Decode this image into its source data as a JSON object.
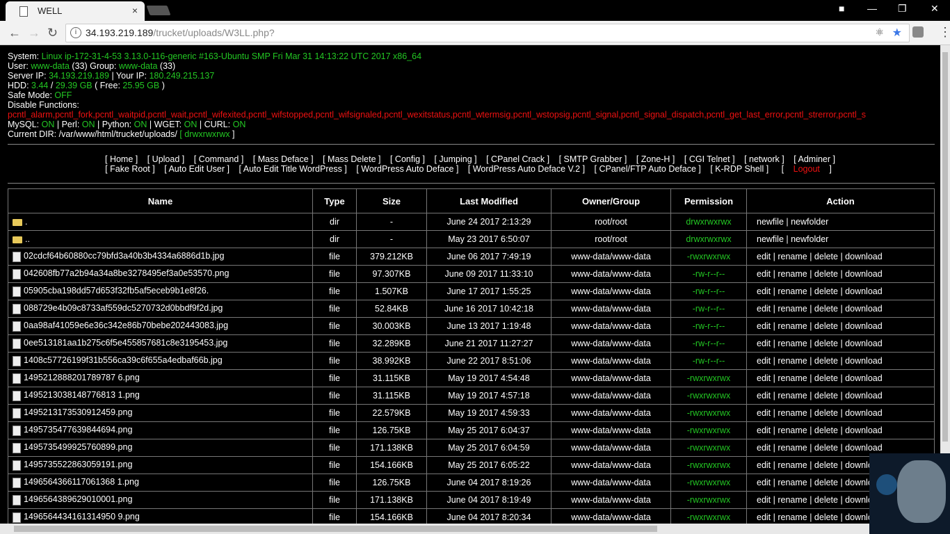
{
  "browser": {
    "tab_title": "WELL",
    "tab_close": "×",
    "url_host": "34.193.219.189",
    "url_path": "/trucket/uploads/W3LL.php?"
  },
  "sysinfo": {
    "system_label": "System:",
    "system_value": "Linux ip-172-31-4-53 3.13.0-116-generic #163-Ubuntu SMP Fri Mar 31 14:13:22 UTC 2017 x86_64",
    "user_label": "User:",
    "user_value": "www-data",
    "user_id": "(33)",
    "group_label": "Group:",
    "group_value": "www-data",
    "group_id": "(33)",
    "server_ip_label": "Server IP:",
    "server_ip": "34.193.219.189",
    "your_ip_label": "| Your IP:",
    "your_ip": "180.249.215.137",
    "hdd_label": "HDD:",
    "hdd_used": "3.44",
    "hdd_total": "29.39 GB",
    "hdd_free_label": "( Free:",
    "hdd_free": "25.95 GB",
    "hdd_close": ")",
    "safe_mode_label": "Safe Mode:",
    "safe_mode": "OFF",
    "disable_label": "Disable Functions:",
    "disable_value": "pcntl_alarm,pcntl_fork,pcntl_waitpid,pcntl_wait,pcntl_wifexited,pcntl_wifstopped,pcntl_wifsignaled,pcntl_wexitstatus,pcntl_wtermsig,pcntl_wstopsig,pcntl_signal,pcntl_signal_dispatch,pcntl_get_last_error,pcntl_strerror,pcntl_s",
    "mysql_label": "MySQL:",
    "mysql": "ON",
    "perl_label": "| Perl:",
    "perl": "ON",
    "python_label": "| Python:",
    "python": "ON",
    "wget_label": "| WGET:",
    "wget": "ON",
    "curl_label": "| CURL:",
    "curl": "ON",
    "cwd_label": "Current DIR: /var/www/html/trucket/uploads/",
    "cwd_perm_open": "[",
    "cwd_perm": "drwxrwxrwx",
    "cwd_perm_close": "]"
  },
  "menu": {
    "row1": [
      "[ Home ]",
      "[ Upload ]",
      "[ Command ]",
      "[ Mass Deface ]",
      "[ Mass Delete ]",
      "[ Config ]",
      "[ Jumping ]",
      "[ CPanel Crack ]",
      "[ SMTP Grabber ]",
      "[ Zone-H ]",
      "[ CGI Telnet ]",
      "[ network ]",
      "[ Adminer ]"
    ],
    "row2": [
      "[ Fake Root ]",
      "[ Auto Edit User ]",
      "[ Auto Edit Title WordPress ]",
      "[ WordPress Auto Deface ]",
      "[ WordPress Auto Deface V.2 ]",
      "[ CPanel/FTP Auto Deface ]",
      "[ K-RDP Shell ]"
    ],
    "logout_open": "[",
    "logout": "Logout",
    "logout_close": "]"
  },
  "table": {
    "headers": [
      "Name",
      "Type",
      "Size",
      "Last Modified",
      "Owner/Group",
      "Permission",
      "Action"
    ],
    "rows": [
      {
        "name": ".",
        "kind": "folder",
        "type": "dir",
        "size": "-",
        "modified": "June 24 2017 2:13:29",
        "owner": "root/root",
        "perm": "drwxrwxrwx",
        "action": "newfile | newfolder"
      },
      {
        "name": "..",
        "kind": "folder",
        "type": "dir",
        "size": "-",
        "modified": "May 23 2017 6:50:07",
        "owner": "root/root",
        "perm": "drwxrwxrwx",
        "action": "newfile | newfolder"
      },
      {
        "name": "02cdcf64b60880cc79bfd3a40b3b4334a6886d1b.jpg",
        "kind": "file",
        "type": "file",
        "size": "379.212KB",
        "modified": "June 06 2017 7:49:19",
        "owner": "www-data/www-data",
        "perm": "-rwxrwxrwx",
        "action": "edit | rename | delete | download"
      },
      {
        "name": "042608fb77a2b94a34a8be3278495ef3a0e53570.png",
        "kind": "file",
        "type": "file",
        "size": "97.307KB",
        "modified": "June 09 2017 11:33:10",
        "owner": "www-data/www-data",
        "perm": "-rw-r--r--",
        "action": "edit | rename | delete | download"
      },
      {
        "name": "05905cba198dd57d653f32fb5af5eceb9b1e8f26.",
        "kind": "file",
        "type": "file",
        "size": "1.507KB",
        "modified": "June 17 2017 1:55:25",
        "owner": "www-data/www-data",
        "perm": "-rw-r--r--",
        "action": "edit | rename | delete | download"
      },
      {
        "name": "088729e4b09c8733af559dc5270732d0bbdf9f2d.jpg",
        "kind": "file",
        "type": "file",
        "size": "52.84KB",
        "modified": "June 16 2017 10:42:18",
        "owner": "www-data/www-data",
        "perm": "-rw-r--r--",
        "action": "edit | rename | delete | download"
      },
      {
        "name": "0aa98af41059e6e36c342e86b70bebe202443083.jpg",
        "kind": "file",
        "type": "file",
        "size": "30.003KB",
        "modified": "June 13 2017 1:19:48",
        "owner": "www-data/www-data",
        "perm": "-rw-r--r--",
        "action": "edit | rename | delete | download"
      },
      {
        "name": "0ee513181aa1b275c6f5e455857681c8e3195453.jpg",
        "kind": "file",
        "type": "file",
        "size": "32.289KB",
        "modified": "June 21 2017 11:27:27",
        "owner": "www-data/www-data",
        "perm": "-rw-r--r--",
        "action": "edit | rename | delete | download"
      },
      {
        "name": "1408c57726199f31b556ca39c6f655a4edbaf66b.jpg",
        "kind": "file",
        "type": "file",
        "size": "38.992KB",
        "modified": "June 22 2017 8:51:06",
        "owner": "www-data/www-data",
        "perm": "-rw-r--r--",
        "action": "edit | rename | delete | download"
      },
      {
        "name": "1495212888201789787 6.png",
        "kind": "file",
        "type": "file",
        "size": "31.115KB",
        "modified": "May 19 2017 4:54:48",
        "owner": "www-data/www-data",
        "perm": "-rwxrwxrwx",
        "action": "edit | rename | delete | download"
      },
      {
        "name": "1495213038148776813 1.png",
        "kind": "file",
        "type": "file",
        "size": "31.115KB",
        "modified": "May 19 2017 4:57:18",
        "owner": "www-data/www-data",
        "perm": "-rwxrwxrwx",
        "action": "edit | rename | delete | download"
      },
      {
        "name": "1495213173530912459.png",
        "kind": "file",
        "type": "file",
        "size": "22.579KB",
        "modified": "May 19 2017 4:59:33",
        "owner": "www-data/www-data",
        "perm": "-rwxrwxrwx",
        "action": "edit | rename | delete | download"
      },
      {
        "name": "1495735477639844694.png",
        "kind": "file",
        "type": "file",
        "size": "126.75KB",
        "modified": "May 25 2017 6:04:37",
        "owner": "www-data/www-data",
        "perm": "-rwxrwxrwx",
        "action": "edit | rename | delete | download"
      },
      {
        "name": "1495735499925760899.png",
        "kind": "file",
        "type": "file",
        "size": "171.138KB",
        "modified": "May 25 2017 6:04:59",
        "owner": "www-data/www-data",
        "perm": "-rwxrwxrwx",
        "action": "edit | rename | delete | download"
      },
      {
        "name": "1495735522863059191.png",
        "kind": "file",
        "type": "file",
        "size": "154.166KB",
        "modified": "May 25 2017 6:05:22",
        "owner": "www-data/www-data",
        "perm": "-rwxrwxrwx",
        "action": "edit | rename | delete | download"
      },
      {
        "name": "1496564366117061368 1.png",
        "kind": "file",
        "type": "file",
        "size": "126.75KB",
        "modified": "June 04 2017 8:19:26",
        "owner": "www-data/www-data",
        "perm": "-rwxrwxrwx",
        "action": "edit | rename | delete | download"
      },
      {
        "name": "1496564389629010001.png",
        "kind": "file",
        "type": "file",
        "size": "171.138KB",
        "modified": "June 04 2017 8:19:49",
        "owner": "www-data/www-data",
        "perm": "-rwxrwxrwx",
        "action": "edit | rename | delete | download"
      },
      {
        "name": "1496564434161314950 9.png",
        "kind": "file",
        "type": "file",
        "size": "154.166KB",
        "modified": "June 04 2017 8:20:34",
        "owner": "www-data/www-data",
        "perm": "-rwxrwxrwx",
        "action": "edit | rename | delete | download"
      }
    ]
  },
  "colors": {
    "green": "#23c723",
    "red": "#e11111"
  }
}
